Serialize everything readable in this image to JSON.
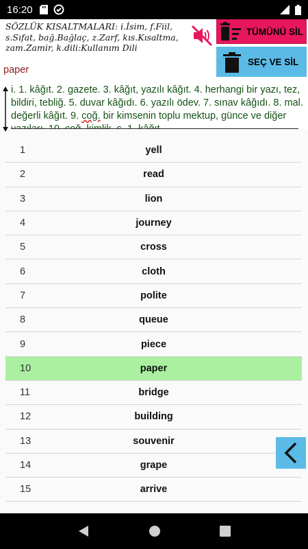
{
  "status": {
    "time": "16:20"
  },
  "header": {
    "abbreviations": "SÖZLÜK KISALTMALARI: i.İsim, f.Fiil, s.Sıfat, bağ.Bağlaç, z.Zarf, kıs.Kısaltma, zam.Zamir, k.dili:Kullanım Dili",
    "selected_word": "paper",
    "delete_all_label": "TÜMÜNÜ SİL",
    "select_delete_label": "SEÇ VE SİL"
  },
  "meaning": {
    "part1": "i. 1. kâğıt. 2. gazete. 3. kâğıt, yazılı kâğıt. 4. herhangi bir yazı, tez, bildiri, tebliğ. 5. duvar kâğıdı. 6. yazılı ödev. 7. sınav kâğıdı. 8. mal. değerli kâğıt. 9. ",
    "coq": "coğ.",
    "part2": " bir kimsenin toplu mektup, günce ve diğer yazıları. 10. coğ. kimlik. s. 1. kâğıt"
  },
  "words": [
    {
      "n": "1",
      "w": "yell"
    },
    {
      "n": "2",
      "w": "read"
    },
    {
      "n": "3",
      "w": "lion"
    },
    {
      "n": "4",
      "w": "journey"
    },
    {
      "n": "5",
      "w": "cross"
    },
    {
      "n": "6",
      "w": "cloth"
    },
    {
      "n": "7",
      "w": "polite"
    },
    {
      "n": "8",
      "w": "queue"
    },
    {
      "n": "9",
      "w": "piece"
    },
    {
      "n": "10",
      "w": "paper"
    },
    {
      "n": "11",
      "w": "bridge"
    },
    {
      "n": "12",
      "w": "building"
    },
    {
      "n": "13",
      "w": "souvenir"
    },
    {
      "n": "14",
      "w": "grape"
    },
    {
      "n": "15",
      "w": "arrive"
    }
  ],
  "selected_index": 9,
  "colors": {
    "delete_all": "#e8175d",
    "select_delete": "#5bbbe6",
    "selected_row": "#aaf0a0",
    "word_title": "#8b1a1a",
    "meaning_text": "#145214"
  },
  "icons": {
    "mute": "volume-off-icon",
    "delete_all": "delete-sweep-icon",
    "select_delete": "trash-icon",
    "back": "chevron-left-icon"
  }
}
